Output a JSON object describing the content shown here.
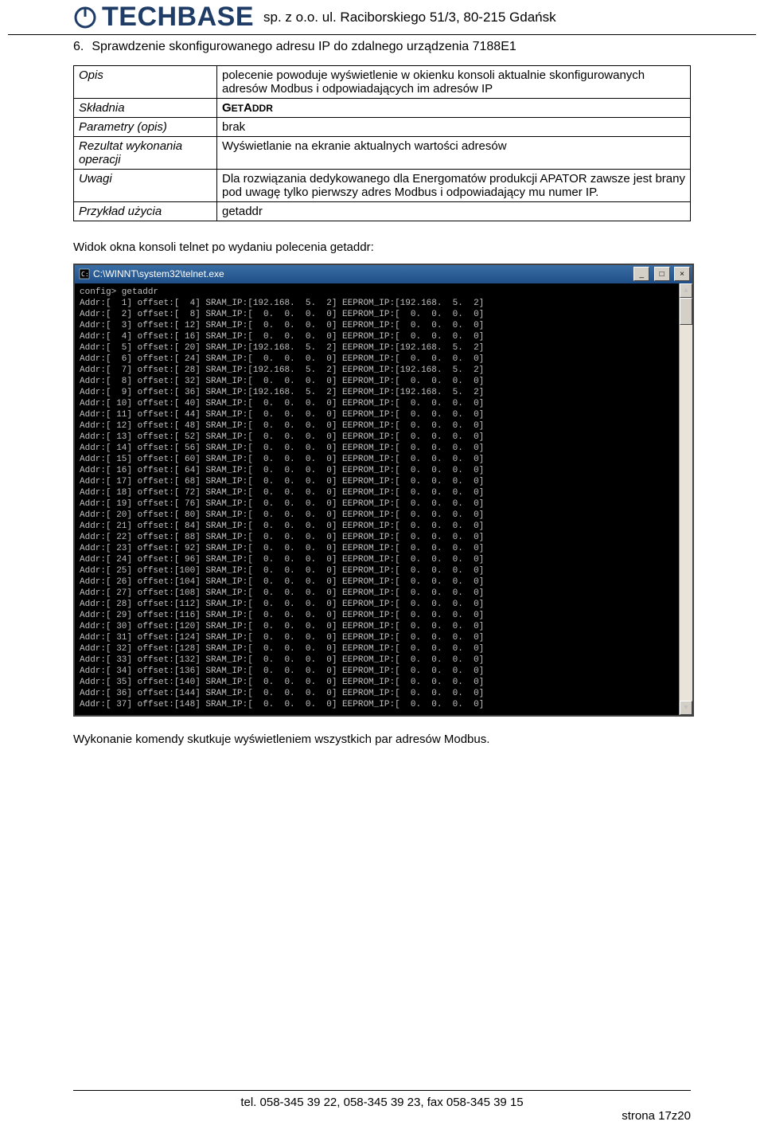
{
  "header": {
    "logo_text": "TECHBASE",
    "company_line": "sp. z o.o. ul. Raciborskiego 51/3, 80-215 Gdańsk"
  },
  "section": {
    "number": "6.",
    "title": "Sprawdzenie skonfigurowanego adresu IP do zdalnego urządzenia 7188E1"
  },
  "spec_table": {
    "rows": [
      {
        "label": "Opis",
        "value": "polecenie powoduje wyświetlenie w okienku konsoli aktualnie skonfigurowanych adresów Modbus i odpowiadających im adresów IP"
      },
      {
        "label": "Składnia",
        "value_smallcaps_prefix": "G",
        "value_smallcaps_rest": "ET",
        "value_suffix_prefix": "A",
        "value_suffix_rest": "DDR"
      },
      {
        "label": "Parametry (opis)",
        "value": "brak"
      },
      {
        "label": "Rezultat wykonania operacji",
        "value": "Wyświetlanie na ekranie aktualnych wartości adresów"
      },
      {
        "label": "Uwagi",
        "value": "Dla rozwiązania dedykowanego dla Energomatów produkcji APATOR zawsze jest brany pod uwagę tylko pierwszy adres Modbus i odpowiadający mu numer IP."
      },
      {
        "label": "Przykład użycia",
        "value": "getaddr"
      }
    ]
  },
  "caption": "Widok okna konsoli telnet po wydaniu polecenia getaddr:",
  "console": {
    "title": "C:\\WINNT\\system32\\telnet.exe",
    "prompt_line": "config> getaddr",
    "rows": [
      {
        "addr": 1,
        "offset": 4,
        "sram": "192.168.  5.  2",
        "eep": "192.168.  5.  2"
      },
      {
        "addr": 2,
        "offset": 8,
        "sram": "  0.  0.  0.  0",
        "eep": "  0.  0.  0.  0"
      },
      {
        "addr": 3,
        "offset": 12,
        "sram": "  0.  0.  0.  0",
        "eep": "  0.  0.  0.  0"
      },
      {
        "addr": 4,
        "offset": 16,
        "sram": "  0.  0.  0.  0",
        "eep": "  0.  0.  0.  0"
      },
      {
        "addr": 5,
        "offset": 20,
        "sram": "192.168.  5.  2",
        "eep": "192.168.  5.  2"
      },
      {
        "addr": 6,
        "offset": 24,
        "sram": "  0.  0.  0.  0",
        "eep": "  0.  0.  0.  0"
      },
      {
        "addr": 7,
        "offset": 28,
        "sram": "192.168.  5.  2",
        "eep": "192.168.  5.  2"
      },
      {
        "addr": 8,
        "offset": 32,
        "sram": "  0.  0.  0.  0",
        "eep": "  0.  0.  0.  0"
      },
      {
        "addr": 9,
        "offset": 36,
        "sram": "192.168.  5.  2",
        "eep": "192.168.  5.  2"
      },
      {
        "addr": 10,
        "offset": 40,
        "sram": "  0.  0.  0.  0",
        "eep": "  0.  0.  0.  0"
      },
      {
        "addr": 11,
        "offset": 44,
        "sram": "  0.  0.  0.  0",
        "eep": "  0.  0.  0.  0"
      },
      {
        "addr": 12,
        "offset": 48,
        "sram": "  0.  0.  0.  0",
        "eep": "  0.  0.  0.  0"
      },
      {
        "addr": 13,
        "offset": 52,
        "sram": "  0.  0.  0.  0",
        "eep": "  0.  0.  0.  0"
      },
      {
        "addr": 14,
        "offset": 56,
        "sram": "  0.  0.  0.  0",
        "eep": "  0.  0.  0.  0"
      },
      {
        "addr": 15,
        "offset": 60,
        "sram": "  0.  0.  0.  0",
        "eep": "  0.  0.  0.  0"
      },
      {
        "addr": 16,
        "offset": 64,
        "sram": "  0.  0.  0.  0",
        "eep": "  0.  0.  0.  0"
      },
      {
        "addr": 17,
        "offset": 68,
        "sram": "  0.  0.  0.  0",
        "eep": "  0.  0.  0.  0"
      },
      {
        "addr": 18,
        "offset": 72,
        "sram": "  0.  0.  0.  0",
        "eep": "  0.  0.  0.  0"
      },
      {
        "addr": 19,
        "offset": 76,
        "sram": "  0.  0.  0.  0",
        "eep": "  0.  0.  0.  0"
      },
      {
        "addr": 20,
        "offset": 80,
        "sram": "  0.  0.  0.  0",
        "eep": "  0.  0.  0.  0"
      },
      {
        "addr": 21,
        "offset": 84,
        "sram": "  0.  0.  0.  0",
        "eep": "  0.  0.  0.  0"
      },
      {
        "addr": 22,
        "offset": 88,
        "sram": "  0.  0.  0.  0",
        "eep": "  0.  0.  0.  0"
      },
      {
        "addr": 23,
        "offset": 92,
        "sram": "  0.  0.  0.  0",
        "eep": "  0.  0.  0.  0"
      },
      {
        "addr": 24,
        "offset": 96,
        "sram": "  0.  0.  0.  0",
        "eep": "  0.  0.  0.  0"
      },
      {
        "addr": 25,
        "offset": 100,
        "sram": "  0.  0.  0.  0",
        "eep": "  0.  0.  0.  0"
      },
      {
        "addr": 26,
        "offset": 104,
        "sram": "  0.  0.  0.  0",
        "eep": "  0.  0.  0.  0"
      },
      {
        "addr": 27,
        "offset": 108,
        "sram": "  0.  0.  0.  0",
        "eep": "  0.  0.  0.  0"
      },
      {
        "addr": 28,
        "offset": 112,
        "sram": "  0.  0.  0.  0",
        "eep": "  0.  0.  0.  0"
      },
      {
        "addr": 29,
        "offset": 116,
        "sram": "  0.  0.  0.  0",
        "eep": "  0.  0.  0.  0"
      },
      {
        "addr": 30,
        "offset": 120,
        "sram": "  0.  0.  0.  0",
        "eep": "  0.  0.  0.  0"
      },
      {
        "addr": 31,
        "offset": 124,
        "sram": "  0.  0.  0.  0",
        "eep": "  0.  0.  0.  0"
      },
      {
        "addr": 32,
        "offset": 128,
        "sram": "  0.  0.  0.  0",
        "eep": "  0.  0.  0.  0"
      },
      {
        "addr": 33,
        "offset": 132,
        "sram": "  0.  0.  0.  0",
        "eep": "  0.  0.  0.  0"
      },
      {
        "addr": 34,
        "offset": 136,
        "sram": "  0.  0.  0.  0",
        "eep": "  0.  0.  0.  0"
      },
      {
        "addr": 35,
        "offset": 140,
        "sram": "  0.  0.  0.  0",
        "eep": "  0.  0.  0.  0"
      },
      {
        "addr": 36,
        "offset": 144,
        "sram": "  0.  0.  0.  0",
        "eep": "  0.  0.  0.  0"
      },
      {
        "addr": 37,
        "offset": 148,
        "sram": "  0.  0.  0.  0",
        "eep": "  0.  0.  0.  0"
      }
    ],
    "buttons": {
      "min": "_",
      "max": "□",
      "close": "×"
    }
  },
  "afternote": "Wykonanie komendy skutkuje wyświetleniem wszystkich par adresów Modbus.",
  "footer": {
    "tel": "tel. 058-345 39 22, 058-345 39 23, fax 058-345 39 15",
    "page": "strona 17z20"
  }
}
